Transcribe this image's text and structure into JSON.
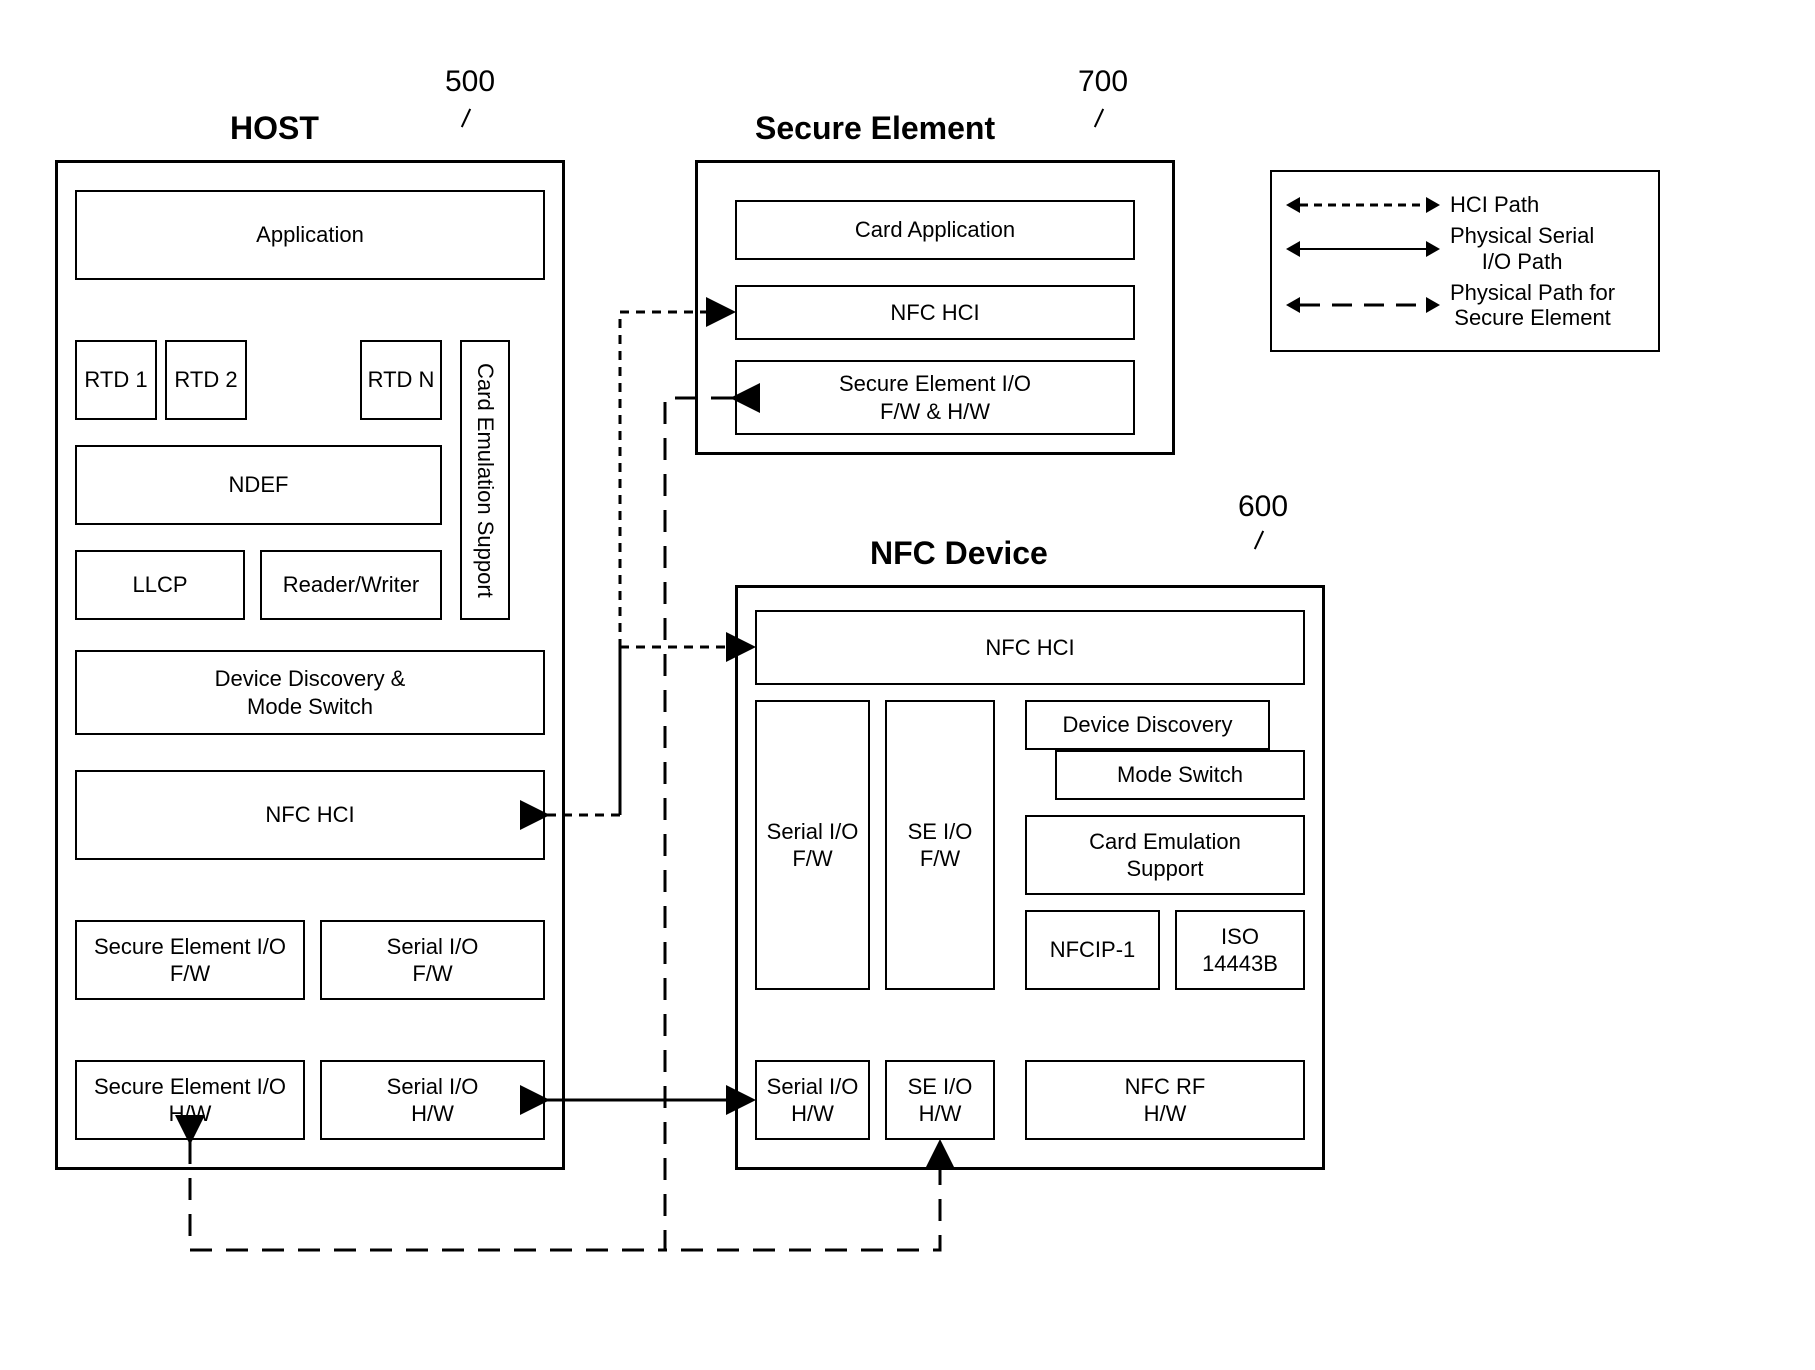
{
  "refs": {
    "host": "500",
    "se": "700",
    "nfc": "600"
  },
  "titles": {
    "host": "HOST",
    "se": "Secure Element",
    "nfc": "NFC Device"
  },
  "host": {
    "application": "Application",
    "rtd1": "RTD 1",
    "rtd2": "RTD 2",
    "rtdn": "RTD N",
    "card_emu": "Card Emulation Support",
    "ndef": "NDEF",
    "llcp": "LLCP",
    "reader_writer": "Reader/Writer",
    "dd_ms": "Device Discovery &\nMode Switch",
    "nfc_hci": "NFC HCI",
    "se_io_fw": "Secure Element I/O\nF/W",
    "serial_io_fw": "Serial I/O\nF/W",
    "se_io_hw": "Secure Element I/O\nH/W",
    "serial_io_hw": "Serial I/O\nH/W"
  },
  "se": {
    "card_app": "Card Application",
    "nfc_hci": "NFC HCI",
    "se_io": "Secure Element I/O\nF/W & H/W"
  },
  "nfc": {
    "nfc_hci": "NFC HCI",
    "serial_io_fw": "Serial I/O\nF/W",
    "se_io_fw": "SE I/O\nF/W",
    "dev_disc": "Device Discovery",
    "mode_switch": "Mode Switch",
    "card_emu": "Card Emulation\nSupport",
    "nfcip1": "NFCIP-1",
    "iso": "ISO\n14443B",
    "serial_io_hw": "Serial I/O\nH/W",
    "se_io_hw": "SE I/O\nH/W",
    "nfc_rf_hw": "NFC RF\nH/W"
  },
  "legend": {
    "hci": "HCI Path",
    "serial": "Physical Serial\nI/O Path",
    "se_path": "Physical Path for\nSecure Element"
  }
}
